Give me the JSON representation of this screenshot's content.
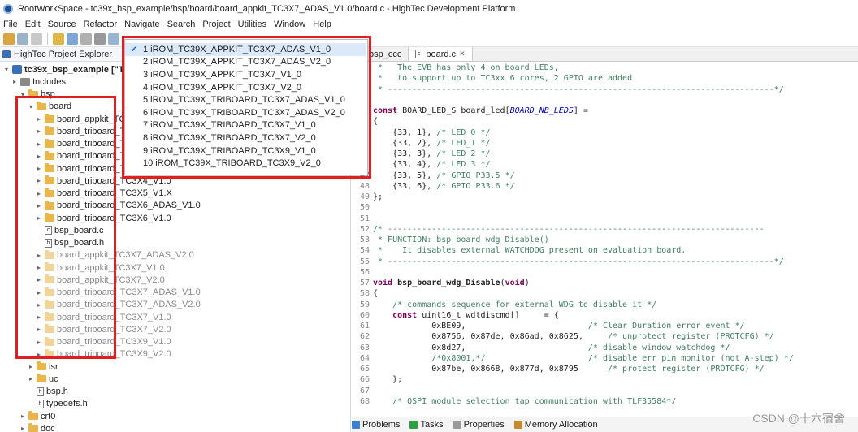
{
  "window": {
    "title": "RootWorkSpace - tc39x_bsp_example/bsp/board/board_appkit_TC3X7_ADAS_V1.0/board.c - HighTec Development Platform"
  },
  "menu": [
    "File",
    "Edit",
    "Source",
    "Refactor",
    "Navigate",
    "Search",
    "Project",
    "Utilities",
    "Window",
    "Help"
  ],
  "explorer": {
    "tab_label": "HighTec Project Explorer",
    "items": [
      {
        "label": "tc39x_bsp_example [\"TriCore",
        "kind": "project",
        "bold": true
      },
      {
        "label": "Includes",
        "kind": "include"
      },
      {
        "label": "bsp",
        "kind": "folder"
      },
      {
        "label": "board",
        "kind": "folder"
      },
      {
        "label": "board_appkit_TC3X7_ADAS_V1.0",
        "kind": "folder"
      },
      {
        "label": "board_triboard_TC3X4_V1.0",
        "kind": "folder"
      },
      {
        "label": "board_triboard_TC3X7_ADAS_V1.0",
        "kind": "folder"
      },
      {
        "label": "board_triboard_TC3X7_ADAS_V2.0",
        "kind": "folder"
      },
      {
        "label": "board_triboard_TC3X4_V1.0",
        "kind": "folder"
      },
      {
        "label": "board_triboard_TC3X4_V1.0",
        "kind": "folder"
      },
      {
        "label": "board_triboard_TC3X5_V1.X",
        "kind": "folder"
      },
      {
        "label": "board_triboard_TC3X6_ADAS_V1.0",
        "kind": "folder"
      },
      {
        "label": "board_triboard_TC3X6_V1.0",
        "kind": "folder"
      },
      {
        "label": "bsp_board.c",
        "kind": "c"
      },
      {
        "label": "bsp_board.h",
        "kind": "h"
      },
      {
        "label": "board_appkit_TC3X7_ADAS_V2.0",
        "kind": "folder",
        "dim": true
      },
      {
        "label": "board_appkit_TC3X7_V1.0",
        "kind": "folder",
        "dim": true
      },
      {
        "label": "board_appkit_TC3X7_V2.0",
        "kind": "folder",
        "dim": true
      },
      {
        "label": "board_triboard_TC3X7_ADAS_V1.0",
        "kind": "folder",
        "dim": true
      },
      {
        "label": "board_triboard_TC3X7_ADAS_V2.0",
        "kind": "folder",
        "dim": true
      },
      {
        "label": "board_triboard_TC3X7_V1.0",
        "kind": "folder",
        "dim": true
      },
      {
        "label": "board_triboard_TC3X7_V2.0",
        "kind": "folder",
        "dim": true
      },
      {
        "label": "board_triboard_TC3X9_V1.0",
        "kind": "folder",
        "dim": true
      },
      {
        "label": "board_triboard_TC3X9_V2.0",
        "kind": "folder",
        "dim": true
      },
      {
        "label": "isr",
        "kind": "folder"
      },
      {
        "label": "uc",
        "kind": "folder"
      },
      {
        "label": "bsp.h",
        "kind": "h"
      },
      {
        "label": "typedefs.h",
        "kind": "h"
      },
      {
        "label": "crt0",
        "kind": "folder"
      },
      {
        "label": "doc",
        "kind": "folder"
      }
    ]
  },
  "dropdown": {
    "items": [
      "1 iROM_TC39X_APPKIT_TC3X7_ADAS_V1_0",
      "2 iROM_TC39X_APPKIT_TC3X7_ADAS_V2_0",
      "3 iROM_TC39X_APPKIT_TC3X7_V1_0",
      "4 iROM_TC39X_APPKIT_TC3X7_V2_0",
      "5 iROM_TC39X_TRIBOARD_TC3X7_ADAS_V1_0",
      "6 iROM_TC39X_TRIBOARD_TC3X7_ADAS_V2_0",
      "7 iROM_TC39X_TRIBOARD_TC3X7_V1_0",
      "8 iROM_TC39X_TRIBOARD_TC3X7_V2_0",
      "9 iROM_TC39X_TRIBOARD_TC3X9_V1_0",
      "10 iROM_TC39X_TRIBOARD_TC3X9_V2_0"
    ],
    "selected_index": 0
  },
  "editor": {
    "tabs": [
      "bsp_ccc",
      "board.c"
    ],
    "lines": [
      {
        "n": "",
        "t": " *   The EVB has only 4 on board LEDs,",
        "c": "cmt"
      },
      {
        "n": "",
        "t": " *   to support up to TC3xx 6 cores, 2 GPIO are added",
        "c": "cmt"
      },
      {
        "n": "",
        "t": " * -------------------------------------------------------------------------------*/",
        "c": "cmt"
      },
      {
        "n": "",
        "t": "",
        "c": ""
      },
      {
        "n": "",
        "t": "const BOARD_LED_S board_led[BOARD_NB_LEDS] =",
        "c": "decl"
      },
      {
        "n": "",
        "t": "{",
        "c": ""
      },
      {
        "n": "",
        "t": "    {33, 1}, /* LED 0 */",
        "c": "mix"
      },
      {
        "n": "",
        "t": "    {33, 2}, /* LED_1 */",
        "c": "mix"
      },
      {
        "n": "",
        "t": "    {33, 3}, /* LED_2 */",
        "c": "mix"
      },
      {
        "n": "",
        "t": "    {33, 4}, /* LED 3 */",
        "c": "mix"
      },
      {
        "n": "47",
        "t": "    {33, 5}, /* GPIO P33.5 */",
        "c": "mix"
      },
      {
        "n": "48",
        "t": "    {33, 6}, /* GPIO P33.6 */",
        "c": "mix"
      },
      {
        "n": "49",
        "t": "};",
        "c": ""
      },
      {
        "n": "50",
        "t": "",
        "c": ""
      },
      {
        "n": "51",
        "t": "",
        "c": ""
      },
      {
        "n": "52",
        "t": "/* -----------------------------------------------------------------------------",
        "c": "cmt"
      },
      {
        "n": "53",
        "t": " * FUNCTION: bsp_board_wdg_Disable()",
        "c": "cmt"
      },
      {
        "n": "54",
        "t": " *    It disables external WATCHDOG present on evaluation board.",
        "c": "cmt"
      },
      {
        "n": "55",
        "t": " * -------------------------------------------------------------------------------*/",
        "c": "cmt"
      },
      {
        "n": "56",
        "t": "",
        "c": ""
      },
      {
        "n": "57",
        "t": "void bsp_board_wdg_Disable(void)",
        "c": "func"
      },
      {
        "n": "58",
        "t": "{",
        "c": ""
      },
      {
        "n": "59",
        "t": "    /* commands sequence for external WDG to disable it */",
        "c": "cmt"
      },
      {
        "n": "60",
        "t": "    const uint16_t wdtdiscmd[]     = {",
        "c": "constline"
      },
      {
        "n": "61",
        "t": "            0xBE09,                         /* Clear Duration error event */",
        "c": "hexcmt"
      },
      {
        "n": "62",
        "t": "            0x8756, 0x87de, 0x86ad, 0x8625,     /* unprotect register (PROTCFG) */",
        "c": "hexcmt"
      },
      {
        "n": "63",
        "t": "            0x8d27,                         /* disable window watchdog */",
        "c": "hexcmt"
      },
      {
        "n": "64",
        "t": "            /*0x8001,*/                     /* disable err pin monitor (not A-step) */",
        "c": "cmt"
      },
      {
        "n": "65",
        "t": "            0x87be, 0x8668, 0x877d, 0x8795      /* protect register (PROTCFG) */",
        "c": "hexcmt"
      },
      {
        "n": "66",
        "t": "    };",
        "c": ""
      },
      {
        "n": "67",
        "t": "",
        "c": ""
      },
      {
        "n": "68",
        "t": "    /* QSPI module selection tap communication with TLF35584*/",
        "c": "cmt"
      }
    ]
  },
  "bottom": {
    "tabs": [
      "Problems",
      "Tasks",
      "Properties",
      "Memory Allocation"
    ]
  },
  "watermark": "CSDN @十六宿舍"
}
